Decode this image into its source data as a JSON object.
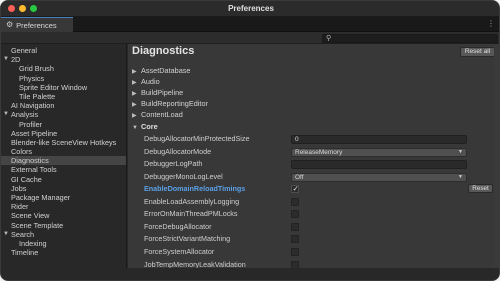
{
  "window": {
    "title": "Preferences"
  },
  "tab": {
    "icon": "gear-icon",
    "label": "Preferences",
    "menu_icon": "more-vertical-icon"
  },
  "search": {
    "placeholder": "",
    "value": "",
    "icon": "search-icon"
  },
  "sidebar": {
    "items": [
      {
        "label": "General",
        "indent": 0,
        "caret": ""
      },
      {
        "label": "2D",
        "indent": 0,
        "caret": "down"
      },
      {
        "label": "Grid Brush",
        "indent": 2,
        "caret": ""
      },
      {
        "label": "Physics",
        "indent": 2,
        "caret": ""
      },
      {
        "label": "Sprite Editor Window",
        "indent": 2,
        "caret": ""
      },
      {
        "label": "Tile Palette",
        "indent": 2,
        "caret": ""
      },
      {
        "label": "AI Navigation",
        "indent": 0,
        "caret": ""
      },
      {
        "label": "Analysis",
        "indent": 0,
        "caret": "down"
      },
      {
        "label": "Profiler",
        "indent": 2,
        "caret": ""
      },
      {
        "label": "Asset Pipeline",
        "indent": 0,
        "caret": ""
      },
      {
        "label": "Blender-like SceneView Hotkeys",
        "indent": 0,
        "caret": ""
      },
      {
        "label": "Colors",
        "indent": 0,
        "caret": ""
      },
      {
        "label": "Diagnostics",
        "indent": 0,
        "caret": "",
        "selected": true
      },
      {
        "label": "External Tools",
        "indent": 0,
        "caret": ""
      },
      {
        "label": "GI Cache",
        "indent": 0,
        "caret": ""
      },
      {
        "label": "Jobs",
        "indent": 0,
        "caret": ""
      },
      {
        "label": "Package Manager",
        "indent": 0,
        "caret": ""
      },
      {
        "label": "Rider",
        "indent": 0,
        "caret": ""
      },
      {
        "label": "Scene View",
        "indent": 0,
        "caret": ""
      },
      {
        "label": "Scene Template",
        "indent": 0,
        "caret": ""
      },
      {
        "label": "Search",
        "indent": 0,
        "caret": "down"
      },
      {
        "label": "Indexing",
        "indent": 2,
        "caret": ""
      },
      {
        "label": "Timeline",
        "indent": 0,
        "caret": ""
      }
    ]
  },
  "main": {
    "heading": "Diagnostics",
    "reset_all_label": "Reset all",
    "groups": [
      {
        "label": "AssetDatabase",
        "expanded": false
      },
      {
        "label": "Audio",
        "expanded": false
      },
      {
        "label": "BuildPipeline",
        "expanded": false
      },
      {
        "label": "BuildReportingEditor",
        "expanded": false
      },
      {
        "label": "ContentLoad",
        "expanded": false
      },
      {
        "label": "Core",
        "expanded": true
      }
    ],
    "core_rows": [
      {
        "label": "DebugAllocatorMinProtectedSize",
        "kind": "text",
        "value": "0",
        "modified": false
      },
      {
        "label": "DebugAllocatorMode",
        "kind": "dropdown",
        "value": "ReleaseMemory",
        "modified": false
      },
      {
        "label": "DebuggerLogPath",
        "kind": "text",
        "value": "",
        "modified": false
      },
      {
        "label": "DebuggerMonoLogLevel",
        "kind": "dropdown",
        "value": "Off",
        "modified": false
      },
      {
        "label": "EnableDomainReloadTimings",
        "kind": "checkbox",
        "checked": true,
        "modified": true,
        "reset_label": "Reset"
      },
      {
        "label": "EnableLoadAssemblyLogging",
        "kind": "checkbox",
        "checked": false,
        "modified": false
      },
      {
        "label": "ErrorOnMainThreadPMLocks",
        "kind": "checkbox",
        "checked": false,
        "modified": false
      },
      {
        "label": "ForceDebugAllocator",
        "kind": "checkbox",
        "checked": false,
        "modified": false
      },
      {
        "label": "ForceStrictVariantMatching",
        "kind": "checkbox",
        "checked": false,
        "modified": false
      },
      {
        "label": "ForceSystemAllocator",
        "kind": "checkbox",
        "checked": false,
        "modified": false
      },
      {
        "label": "JobTempMemoryLeakValidation",
        "kind": "checkbox",
        "checked": false,
        "modified": false
      }
    ]
  },
  "colors": {
    "window_bg": "#282828",
    "content_bg": "#383838",
    "selected_item": "#454545",
    "modified_label": "#5aa1e6",
    "traffic_red": "#fe5f57",
    "traffic_yellow": "#febc2e",
    "traffic_green": "#28c840"
  }
}
